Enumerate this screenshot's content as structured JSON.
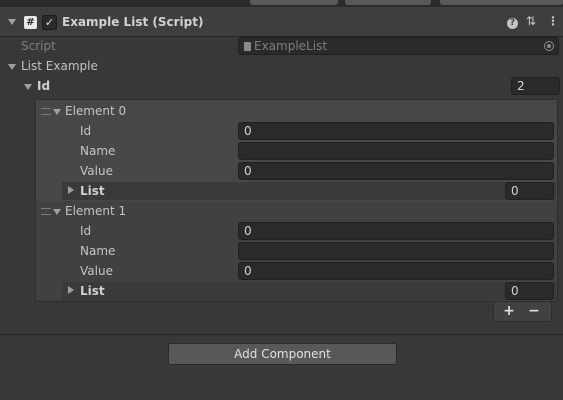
{
  "component": {
    "title": "Example List (Script)",
    "script_icon": "#",
    "enabled_check": "✓"
  },
  "header_icons": {
    "help": "?",
    "presets": "⇅",
    "menu": "⋮"
  },
  "script_field": {
    "label": "Script",
    "value": "ExampleList"
  },
  "list_example": {
    "label": "List Example",
    "id_label": "Id",
    "size": "2"
  },
  "elements": [
    {
      "label": "Element 0",
      "id_label": "Id",
      "id_value": "0",
      "name_label": "Name",
      "name_value": "",
      "value_label": "Value",
      "value_value": "0",
      "list_label": "List",
      "list_size": "0"
    },
    {
      "label": "Element 1",
      "id_label": "Id",
      "id_value": "0",
      "name_label": "Name",
      "name_value": "",
      "value_label": "Value",
      "value_value": "0",
      "list_label": "List",
      "list_size": "0"
    }
  ],
  "list_buttons": {
    "add": "+",
    "remove": "−"
  },
  "add_component_label": "Add Component",
  "colors": {
    "background": "#383838",
    "field": "#2a2a2a",
    "button": "#585858",
    "text": "#c4c4c4"
  }
}
